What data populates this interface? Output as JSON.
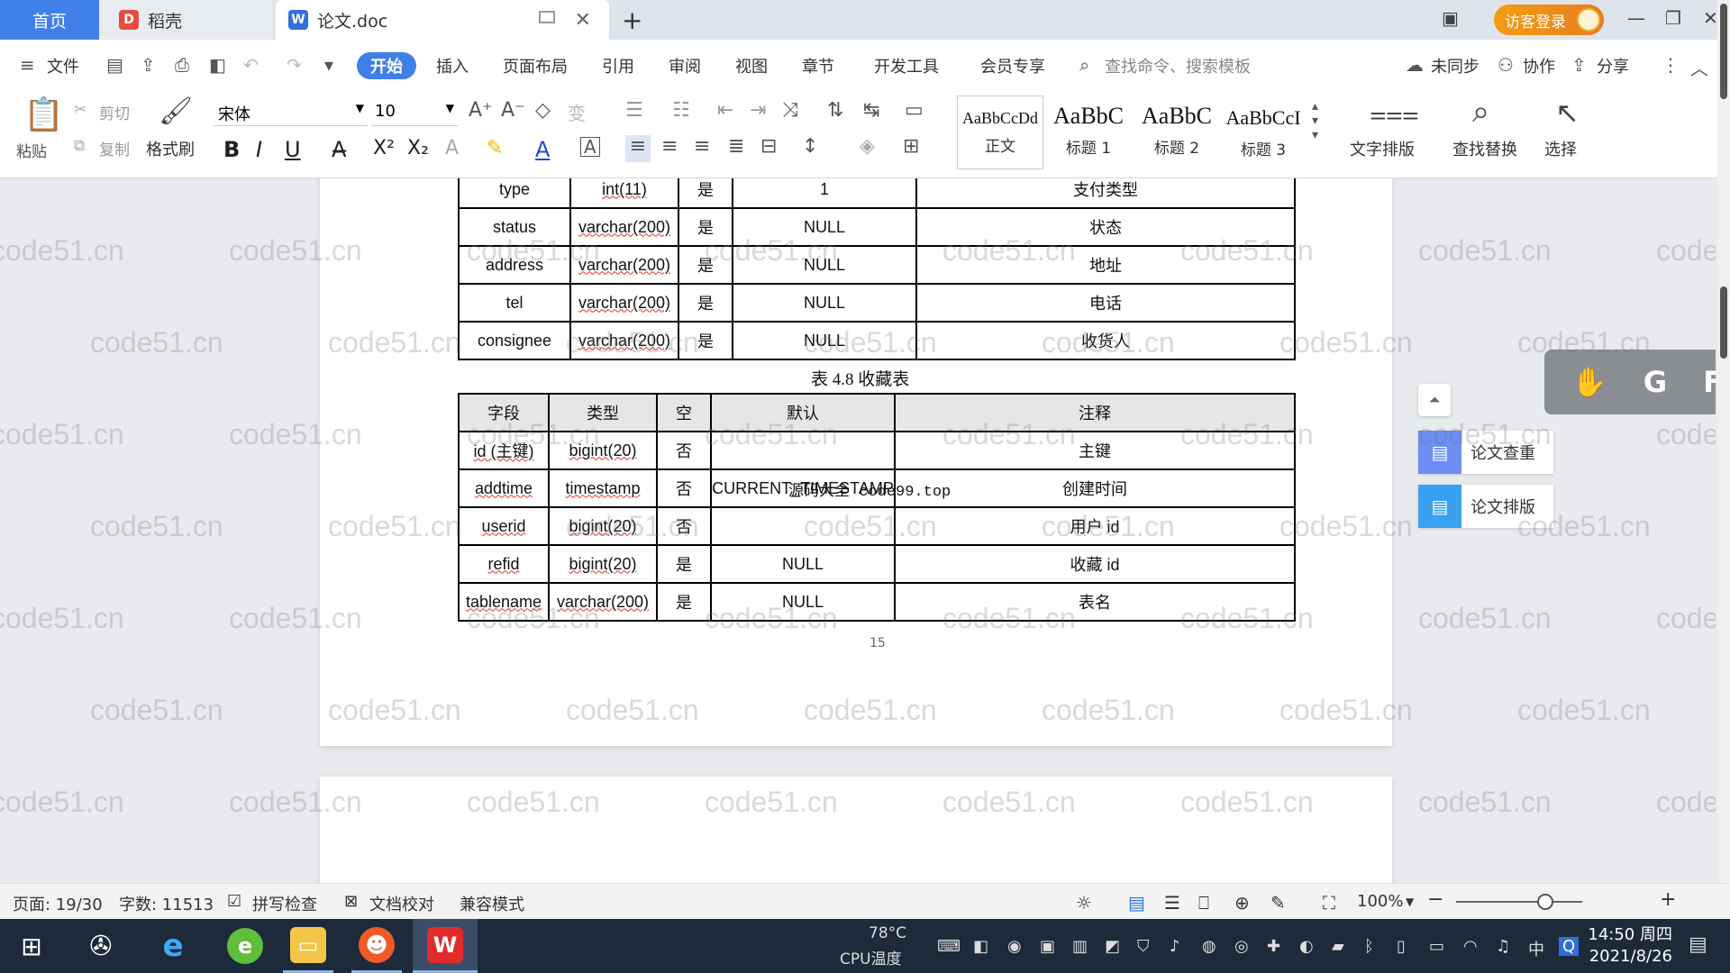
{
  "titlebar": {
    "tabs": [
      {
        "label": "首页"
      },
      {
        "label": "稻壳"
      },
      {
        "label": "论文.doc"
      }
    ],
    "login_label": "访客登录"
  },
  "menu": {
    "file": "文件",
    "items": [
      "开始",
      "插入",
      "页面布局",
      "引用",
      "审阅",
      "视图",
      "章节",
      "开发工具",
      "会员专享"
    ],
    "search_placeholder": "查找命令、搜索模板",
    "sync": "未同步",
    "collab": "协作",
    "share": "分享"
  },
  "toolbar": {
    "paste": "粘贴",
    "cut": "剪切",
    "copy": "复制",
    "format_painter": "格式刷",
    "font": "宋体",
    "size": "10",
    "styles": [
      {
        "sample": "AaBbCcDd",
        "label": "正文"
      },
      {
        "sample": "AaBbC",
        "label": "标题 1"
      },
      {
        "sample": "AaBbC",
        "label": "标题 2"
      },
      {
        "sample": "AaBbCcI",
        "label": "标题 3"
      }
    ],
    "text_layout": "文字排版",
    "find_replace": "查找替换",
    "select": "选择"
  },
  "table1": {
    "rows": [
      [
        "type",
        "int(11)",
        "是",
        "1",
        "支付类型"
      ],
      [
        "status",
        "varchar(200)",
        "是",
        "NULL",
        "状态"
      ],
      [
        "address",
        "varchar(200)",
        "是",
        "NULL",
        "地址"
      ],
      [
        "tel",
        "varchar(200)",
        "是",
        "NULL",
        "电话"
      ],
      [
        "consignee",
        "varchar(200)",
        "是",
        "NULL",
        "收货人"
      ]
    ]
  },
  "caption": "表 4.8  收藏表",
  "table2": {
    "headers": [
      "字段",
      "类型",
      "空",
      "默认",
      "注释"
    ],
    "rows": [
      [
        "id (主键)",
        "bigint(20)",
        "否",
        "",
        "主键"
      ],
      [
        "addtime",
        "timestamp",
        "否",
        "CURRENT_TIMESTAMP",
        "创建时间"
      ],
      [
        "userid",
        "bigint(20)",
        "否",
        "",
        "用户 id"
      ],
      [
        "refid",
        "bigint(20)",
        "是",
        "NULL",
        "收藏 id"
      ],
      [
        "tablename",
        "varchar(200)",
        "是",
        "NULL",
        "表名"
      ]
    ]
  },
  "overlay_text": "源码大全 code99.top",
  "page_number": "15",
  "watermark": "code51.cn",
  "side_panel": {
    "check": "论文查重",
    "layout": "论文排版",
    "float_letters": [
      "G",
      "F"
    ]
  },
  "statusbar": {
    "page": "页面: 19/30",
    "words": "字数: 11513",
    "spell": "拼写检查",
    "proof": "文档校对",
    "compat": "兼容模式",
    "zoom": "100%"
  },
  "taskbar": {
    "temp": "78°C",
    "temp_label": "CPU温度",
    "time": "14:50 周四",
    "date": "2021/8/26",
    "ime": "中"
  }
}
